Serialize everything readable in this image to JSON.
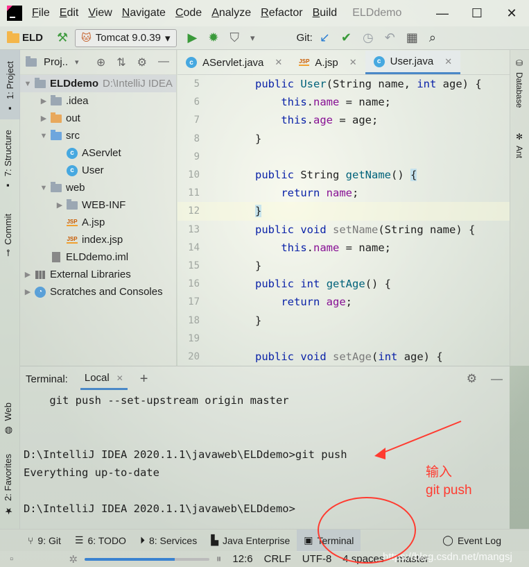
{
  "title_bar": {
    "menu": [
      "File",
      "Edit",
      "View",
      "Navigate",
      "Code",
      "Analyze",
      "Refactor",
      "Build"
    ],
    "project_title": "ELDdemo",
    "controls": [
      "minimize-icon",
      "maximize-icon",
      "close-icon"
    ]
  },
  "toolbar": {
    "project": "ELD",
    "run_config": "Tomcat 9.0.39",
    "git_label": "Git:"
  },
  "left_strip": {
    "project_tab": "1: Project",
    "structure_tab": "7: Structure",
    "commit_tab": "Commit",
    "web_tab": "Web",
    "favorites_tab": "2: Favorites"
  },
  "right_strip": {
    "database_tab": "Database",
    "ant_tab": "Ant"
  },
  "project_panel": {
    "header": "Proj..",
    "tree": [
      {
        "label": "ELDdemo",
        "extra": "D:\\IntelliJ IDEA",
        "indent": 0,
        "arrow": "▼",
        "icon": "folder",
        "bold": true
      },
      {
        "label": ".idea",
        "indent": 1,
        "arrow": "▶",
        "icon": "folder"
      },
      {
        "label": "out",
        "indent": 1,
        "arrow": "▶",
        "icon": "folder-orange"
      },
      {
        "label": "src",
        "indent": 1,
        "arrow": "▼",
        "icon": "folder-blue"
      },
      {
        "label": "AServlet",
        "indent": 2,
        "arrow": "",
        "icon": "class"
      },
      {
        "label": "User",
        "indent": 2,
        "arrow": "",
        "icon": "class"
      },
      {
        "label": "web",
        "indent": 1,
        "arrow": "▼",
        "icon": "folder-web"
      },
      {
        "label": "WEB-INF",
        "indent": 2,
        "arrow": "▶",
        "icon": "folder"
      },
      {
        "label": "A.jsp",
        "indent": 2,
        "arrow": "",
        "icon": "jsp"
      },
      {
        "label": "index.jsp",
        "indent": 2,
        "arrow": "",
        "icon": "jsp"
      },
      {
        "label": "ELDdemo.iml",
        "indent": 1,
        "arrow": "",
        "icon": "iml"
      },
      {
        "label": "External Libraries",
        "indent": 0,
        "arrow": "▶",
        "icon": "library"
      },
      {
        "label": "Scratches and Consoles",
        "indent": 0,
        "arrow": "▶",
        "icon": "scratches"
      }
    ]
  },
  "editor": {
    "tabs": [
      {
        "label": "AServlet.java",
        "icon": "class",
        "active": false
      },
      {
        "label": "A.jsp",
        "icon": "jsp",
        "active": false
      },
      {
        "label": "User.java",
        "icon": "class",
        "active": true
      }
    ],
    "lines": [
      {
        "n": "5",
        "html": "<span class='kw'>public</span> <span class='mth'>User</span>(String name, <span class='kw'>int</span> age) {"
      },
      {
        "n": "6",
        "html": "    <span class='kw'>this</span>.<span class='fld-c'>name</span> = name;"
      },
      {
        "n": "7",
        "html": "    <span class='kw'>this</span>.<span class='fld-c'>age</span> = age;"
      },
      {
        "n": "8",
        "html": "}"
      },
      {
        "n": "9",
        "html": ""
      },
      {
        "n": "10",
        "html": "<span class='kw'>public</span> String <span class='mth'>getName</span>() <span class='hl'>{</span>"
      },
      {
        "n": "11",
        "html": "    <span class='kw'>return</span> <span class='fld-c'>name</span>;"
      },
      {
        "n": "12",
        "html": "<span class='hl'>}</span>",
        "current": true
      },
      {
        "n": "13",
        "html": "<span class='kw'>public</span> <span class='kw'>void</span> <span class='dimfn'>setName</span>(String name) {"
      },
      {
        "n": "14",
        "html": "    <span class='kw'>this</span>.<span class='fld-c'>name</span> = name;"
      },
      {
        "n": "15",
        "html": "}"
      },
      {
        "n": "16",
        "html": "<span class='kw'>public</span> <span class='kw'>int</span> <span class='mth'>getAge</span>() {"
      },
      {
        "n": "17",
        "html": "    <span class='kw'>return</span> <span class='fld-c'>age</span>;"
      },
      {
        "n": "18",
        "html": "}"
      },
      {
        "n": "19",
        "html": ""
      },
      {
        "n": "20",
        "html": "<span class='kw'>public</span> <span class='kw'>void</span> <span class='dimfn'>setAge</span>(<span class='kw'>int</span> age) {"
      }
    ]
  },
  "terminal": {
    "label": "Terminal:",
    "tab": "Local",
    "lines": [
      "    git push --set-upstream origin master",
      "",
      "",
      "D:\\IntelliJ IDEA 2020.1.1\\javaweb\\ELDdemo>git push",
      "Everything up-to-date",
      "",
      "D:\\IntelliJ IDEA 2020.1.1\\javaweb\\ELDdemo>"
    ],
    "annotation_line1": "输入",
    "annotation_line2": "git push"
  },
  "bottom_bar": {
    "git": "9: Git",
    "todo": "6: TODO",
    "services": "8: Services",
    "java_enterprise": "Java Enterprise",
    "terminal": "Terminal",
    "event_log": "Event Log"
  },
  "status_bar": {
    "progress": 0.72,
    "position": "12:6",
    "line_ending": "CRLF",
    "encoding": "UTF-8",
    "indent": "4 spaces",
    "branch": "master",
    "watermark": "https://blog.csdn.net/mangsj"
  }
}
